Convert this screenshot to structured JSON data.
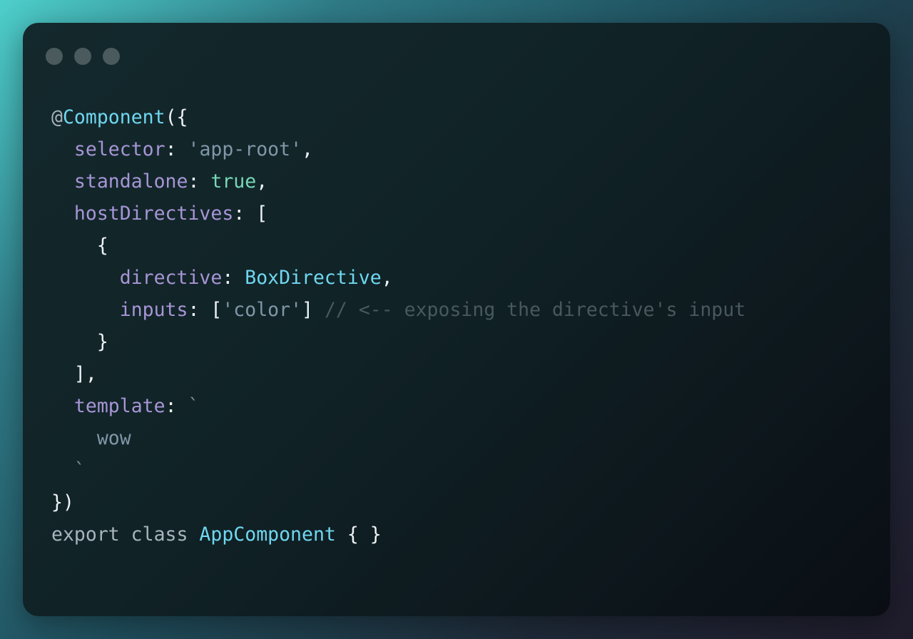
{
  "window": {
    "dots": [
      "close",
      "minimize",
      "maximize"
    ]
  },
  "code": {
    "lines": [
      [
        {
          "t": "@",
          "c": "decor"
        },
        {
          "t": "Component",
          "c": "class"
        },
        {
          "t": "({",
          "c": "punc"
        }
      ],
      [
        {
          "t": "  ",
          "c": "punc"
        },
        {
          "t": "selector",
          "c": "prop"
        },
        {
          "t": ": ",
          "c": "punc"
        },
        {
          "t": "'app-root'",
          "c": "str"
        },
        {
          "t": ",",
          "c": "punc"
        }
      ],
      [
        {
          "t": "  ",
          "c": "punc"
        },
        {
          "t": "standalone",
          "c": "prop"
        },
        {
          "t": ": ",
          "c": "punc"
        },
        {
          "t": "true",
          "c": "bool"
        },
        {
          "t": ",",
          "c": "punc"
        }
      ],
      [
        {
          "t": "  ",
          "c": "punc"
        },
        {
          "t": "hostDirectives",
          "c": "prop"
        },
        {
          "t": ": [",
          "c": "punc"
        }
      ],
      [
        {
          "t": "    {",
          "c": "punc"
        }
      ],
      [
        {
          "t": "      ",
          "c": "punc"
        },
        {
          "t": "directive",
          "c": "prop"
        },
        {
          "t": ": ",
          "c": "punc"
        },
        {
          "t": "BoxDirective",
          "c": "class"
        },
        {
          "t": ",",
          "c": "punc"
        }
      ],
      [
        {
          "t": "      ",
          "c": "punc"
        },
        {
          "t": "inputs",
          "c": "prop"
        },
        {
          "t": ": [",
          "c": "punc"
        },
        {
          "t": "'color'",
          "c": "str"
        },
        {
          "t": "] ",
          "c": "punc"
        },
        {
          "t": "// <-- exposing the directive's input",
          "c": "comment"
        }
      ],
      [
        {
          "t": "    }",
          "c": "punc"
        }
      ],
      [
        {
          "t": "  ],",
          "c": "punc"
        }
      ],
      [
        {
          "t": "  ",
          "c": "punc"
        },
        {
          "t": "template",
          "c": "prop"
        },
        {
          "t": ": ",
          "c": "punc"
        },
        {
          "t": "`",
          "c": "tick"
        }
      ],
      [
        {
          "t": "    wow",
          "c": "str"
        }
      ],
      [
        {
          "t": "  `",
          "c": "tick"
        }
      ],
      [
        {
          "t": "})",
          "c": "punc"
        }
      ],
      [
        {
          "t": "export class ",
          "c": "kw"
        },
        {
          "t": "AppComponent",
          "c": "class"
        },
        {
          "t": " { }",
          "c": "punc"
        }
      ]
    ]
  }
}
